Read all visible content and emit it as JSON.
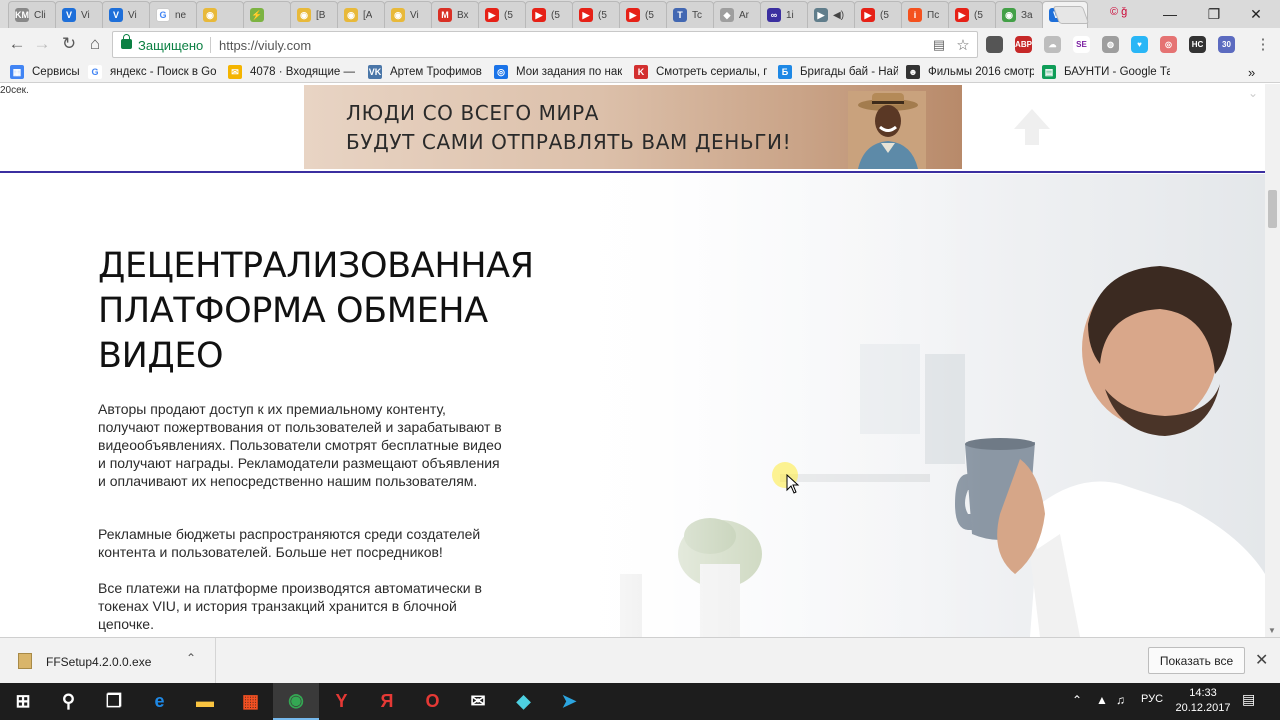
{
  "browser": {
    "tabs": [
      {
        "fav": "KM",
        "title": "Cli",
        "color": "#888888"
      },
      {
        "fav": "V",
        "title": "Vi",
        "color": "#1e6fd9"
      },
      {
        "fav": "V",
        "title": "Vi",
        "color": "#1e6fd9"
      },
      {
        "fav": "G",
        "title": "ne",
        "color": "#ffffff"
      },
      {
        "fav": "◉",
        "title": "",
        "color": "#e8b93a"
      },
      {
        "fav": "⚡",
        "title": "",
        "color": "#7cb342"
      },
      {
        "fav": "◉",
        "title": "[B",
        "color": "#e8b93a"
      },
      {
        "fav": "◉",
        "title": "[A",
        "color": "#e8b93a"
      },
      {
        "fav": "◉",
        "title": "Vi",
        "color": "#e8b93a"
      },
      {
        "fav": "M",
        "title": "Вх",
        "color": "#d93025"
      },
      {
        "fav": "▶",
        "title": "(5",
        "color": "#e62117"
      },
      {
        "fav": "▶",
        "title": "(5",
        "color": "#e62117"
      },
      {
        "fav": "▶",
        "title": "(5",
        "color": "#e62117"
      },
      {
        "fav": "▶",
        "title": "(5",
        "color": "#e62117"
      },
      {
        "fav": "T",
        "title": "Tc",
        "color": "#4267b2"
      },
      {
        "fav": "◆",
        "title": "Ar",
        "color": "#9e9e9e"
      },
      {
        "fav": "∞",
        "title": "1i",
        "color": "#3b2fa0"
      },
      {
        "fav": "▶",
        "title": "◀)",
        "color": "#607d8b"
      },
      {
        "fav": "▶",
        "title": "(5",
        "color": "#e62117"
      },
      {
        "fav": "i",
        "title": "Пс",
        "color": "#f4511e"
      },
      {
        "fav": "▶",
        "title": "(5",
        "color": "#e62117"
      },
      {
        "fav": "◉",
        "title": "За",
        "color": "#43a047"
      },
      {
        "fav": "V",
        "title": "",
        "color": "#1e6fd9",
        "active": true
      }
    ],
    "profile_label": "© ǧ",
    "url_secure_label": "Защищено",
    "url": "https://viuly.com",
    "extensions": [
      {
        "name": "ext-square-icon",
        "label": "",
        "color": "#555555"
      },
      {
        "name": "ext-abp-icon",
        "label": "ABP",
        "color": "#c62828"
      },
      {
        "name": "ext-cloud-icon",
        "label": "☁",
        "color": "#bdbdbd"
      },
      {
        "name": "ext-se-icon",
        "label": "SE",
        "color": "#ffffff"
      },
      {
        "name": "ext-globe-icon",
        "label": "◍",
        "color": "#9e9e9e"
      },
      {
        "name": "ext-heart-icon",
        "label": "♥",
        "color": "#29b6f6"
      },
      {
        "name": "ext-ring-icon",
        "label": "◎",
        "color": "#e57373"
      },
      {
        "name": "ext-hc-icon",
        "label": "HC",
        "color": "#333333"
      },
      {
        "name": "ext-badge-icon",
        "label": "30",
        "color": "#5c6bc0"
      }
    ],
    "bookmarks": [
      {
        "icon": "▦",
        "label": "Сервисы",
        "color": "#4285f4",
        "width": 70
      },
      {
        "icon": "G",
        "label": "яндекс - Поиск в Go",
        "color": "#ffffff",
        "width": 132
      },
      {
        "icon": "✉",
        "label": "4078 · Входящие — ",
        "color": "#f4b400",
        "width": 132
      },
      {
        "icon": "VK",
        "label": "Артем Трофимов",
        "color": "#4a76a8",
        "width": 118
      },
      {
        "icon": "◎",
        "label": "Мои задания по нак",
        "color": "#1a73e8",
        "width": 132
      },
      {
        "icon": "K",
        "label": "Смотреть сериалы, г",
        "color": "#d32f2f",
        "width": 136
      },
      {
        "icon": "Б",
        "label": "Бригады бай - Найд",
        "color": "#1e88e5",
        "width": 120
      },
      {
        "icon": "☻",
        "label": "Фильмы 2016 смотр",
        "color": "#333333",
        "width": 128
      },
      {
        "icon": "▤",
        "label": "БАУНТИ - Google Та",
        "color": "#0f9d58",
        "width": 128
      }
    ],
    "bookmarks_overflow": "»"
  },
  "page": {
    "timer": "20сек.",
    "banner": {
      "line1": "ЛЮДИ СО ВСЕГО МИРА",
      "line2": "БУДУТ САМИ ОТПРАВЛЯТЬ ВАМ ДЕНЬГИ!"
    },
    "hero": {
      "title_lines": [
        "ДЕЦЕНТРАЛИЗОВАННАЯ",
        "ПЛАТФОРМА ОБМЕНА",
        "ВИДЕО"
      ],
      "paragraphs": [
        "Авторы продают доступ к их премиальному контенту, получают пожертвования от пользователей и зарабатывают в видеообъявлениях. Пользователи смотрят бесплатные видео и получают награды. Рекламодатели размещают объявления и оплачивают их непосредственно нашим пользователям.",
        "Рекламные бюджеты распространяются среди создателей контента и пользователей. Больше нет посредников!",
        "Все платежи на платформе производятся автоматически в токенах VIU, и история транзакций хранится в блочной цепочке."
      ]
    }
  },
  "download_bar": {
    "filename": "FFSetup4.2.0.0.exe",
    "show_all_label": "Показать все"
  },
  "taskbar": {
    "apps": [
      {
        "name": "start-button",
        "glyph": "⊞",
        "color": "#ffffff"
      },
      {
        "name": "search-icon",
        "glyph": "⚲",
        "color": "#ffffff"
      },
      {
        "name": "task-view-icon",
        "glyph": "❐",
        "color": "#ffffff"
      },
      {
        "name": "edge-icon",
        "glyph": "e",
        "color": "#1e88e5"
      },
      {
        "name": "explorer-icon",
        "glyph": "▬",
        "color": "#f9c440"
      },
      {
        "name": "store-icon",
        "glyph": "▦",
        "color": "#f25022"
      },
      {
        "name": "chrome-icon",
        "glyph": "◉",
        "color": "#34a853",
        "active": true
      },
      {
        "name": "yandex-browser-icon",
        "glyph": "Y",
        "color": "#e53935"
      },
      {
        "name": "yandex-icon",
        "glyph": "Я",
        "color": "#e53935"
      },
      {
        "name": "opera-icon",
        "glyph": "O",
        "color": "#e53935"
      },
      {
        "name": "mail-icon",
        "glyph": "✉",
        "color": "#ffffff"
      },
      {
        "name": "notes-icon",
        "glyph": "◆",
        "color": "#4dd0e1"
      },
      {
        "name": "telegram-icon",
        "glyph": "➤",
        "color": "#2ca5e0"
      }
    ],
    "language": "РУС",
    "time": "14:33",
    "date": "20.12.2017"
  }
}
